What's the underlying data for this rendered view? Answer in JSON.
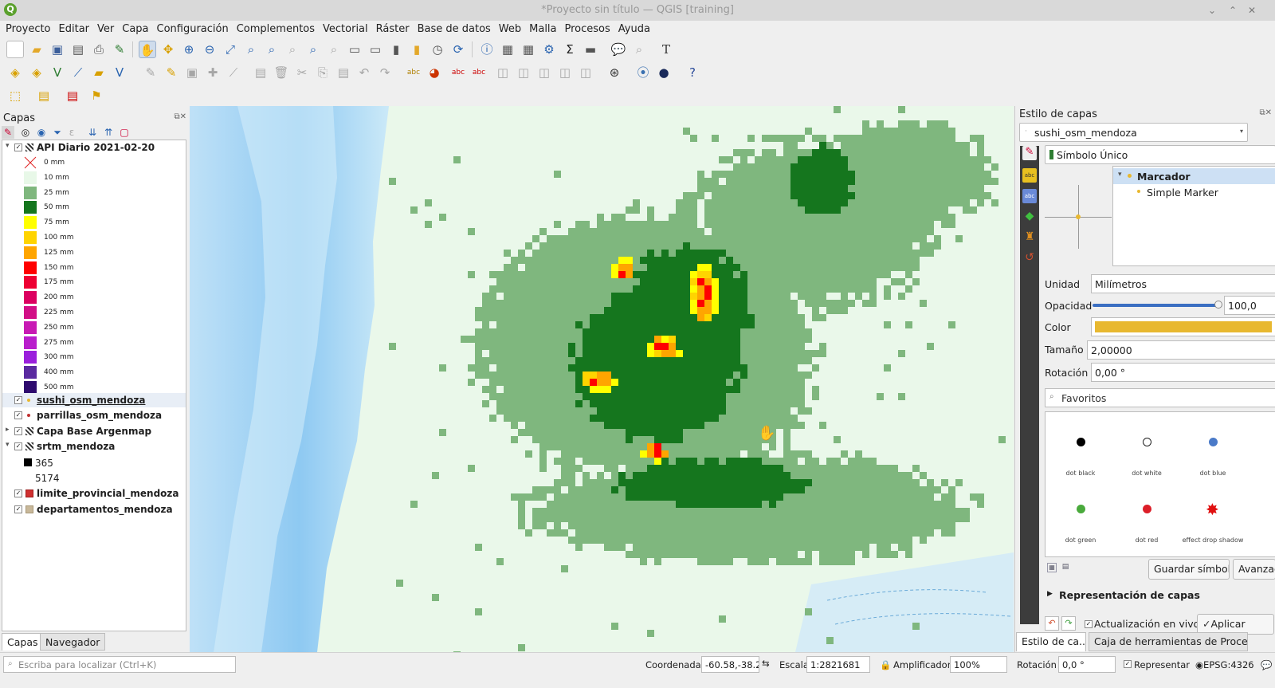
{
  "window": {
    "title": "*Proyecto sin título — QGIS [training]",
    "logo": "Q"
  },
  "menu": [
    "Proyecto",
    "Editar",
    "Ver",
    "Capa",
    "Configuración",
    "Complementos",
    "Vectorial",
    "Ráster",
    "Base de datos",
    "Web",
    "Malla",
    "Procesos",
    "Ayuda"
  ],
  "layers_panel": {
    "title": "Capas",
    "layers": [
      {
        "name": "API Diario 2021-02-20",
        "checked": true,
        "expanded": true,
        "icon": "raster-icon"
      },
      {
        "name": "sushi_osm_mendoza",
        "checked": true,
        "icon": "point-icon"
      },
      {
        "name": "parrillas_osm_mendoza",
        "checked": true,
        "icon": "point-icon"
      },
      {
        "name": "Capa Base Argenmap",
        "checked": true,
        "icon": "raster-icon"
      },
      {
        "name": "srtm_mendoza",
        "checked": true,
        "expanded": true,
        "icon": "raster-icon"
      },
      {
        "name": "limite_provincial_mendoza",
        "checked": true,
        "icon": "polygon-icon"
      },
      {
        "name": "departamentos_mendoza",
        "checked": true,
        "icon": "polygon-icon"
      }
    ],
    "legend": [
      {
        "label": "0 mm",
        "color": "#ffffff"
      },
      {
        "label": "10 mm",
        "color": "#e8f8e8"
      },
      {
        "label": "25 mm",
        "color": "#7fb77e"
      },
      {
        "label": "50 mm",
        "color": "#15761e"
      },
      {
        "label": "75 mm",
        "color": "#ffff00"
      },
      {
        "label": "100 mm",
        "color": "#ffd400"
      },
      {
        "label": "125 mm",
        "color": "#ffa500"
      },
      {
        "label": "150 mm",
        "color": "#ff0000"
      },
      {
        "label": "175 mm",
        "color": "#ee0033"
      },
      {
        "label": "200 mm",
        "color": "#dc0060"
      },
      {
        "label": "225 mm",
        "color": "#d20f86"
      },
      {
        "label": "250 mm",
        "color": "#c81ab4"
      },
      {
        "label": "275 mm",
        "color": "#b91ecc"
      },
      {
        "label": "300 mm",
        "color": "#9a1fdc"
      },
      {
        "label": "400 mm",
        "color": "#5a2aa0"
      },
      {
        "label": "500 mm",
        "color": "#2e0a6e"
      }
    ],
    "srtm_legend": [
      {
        "label": "365",
        "color": "#000000"
      },
      {
        "label": "5174",
        "color": "#ffffff"
      }
    ],
    "tabs": [
      "Capas",
      "Navegador"
    ]
  },
  "style_panel": {
    "title": "Estilo de capas",
    "layer": "sushi_osm_mendoza",
    "renderer": "Símbolo Único",
    "tree": [
      "Marcador",
      "Simple Marker"
    ],
    "unit_label": "Unidad",
    "unit_value": "Milímetros",
    "opacity_label": "Opacidad",
    "opacity_value": "100,0",
    "color_label": "Color",
    "color_value": "#e8b830",
    "size_label": "Tamaño",
    "size_value": "2,00000",
    "rotation_label": "Rotación",
    "rotation_value": "0,00 °",
    "search_placeholder": "Favoritos",
    "favorites": [
      {
        "label": "dot black",
        "color": "#000000"
      },
      {
        "label": "dot white",
        "color": "#ffffff"
      },
      {
        "label": "dot blue",
        "color": "#4a7ac8"
      },
      {
        "label": "dot green",
        "color": "#4aaa3c"
      },
      {
        "label": "dot red",
        "color": "#dc1e28"
      },
      {
        "label": "effect drop shadow",
        "color": "#e01010"
      }
    ],
    "save_symbol": "Guardar símbolo",
    "advanced": "Avanzado",
    "layer_rendering": "Representación de capas",
    "live_update": "Actualización en vivo",
    "apply": "Aplicar",
    "tabs": [
      "Estilo de ca...",
      "Caja de herramientas de Proce..."
    ]
  },
  "status": {
    "locator_placeholder": "Escriba para localizar (Ctrl+K)",
    "coord_label": "Coordenada",
    "coord_value": "-60.58,-38.22",
    "scale_label": "Escala",
    "scale_value": "1:2821681",
    "magnifier_label": "Amplificador",
    "magnifier_value": "100%",
    "rotation_label": "Rotación",
    "rotation_value": "0,0 °",
    "render_label": "Representar",
    "crs": "EPSG:4326"
  }
}
